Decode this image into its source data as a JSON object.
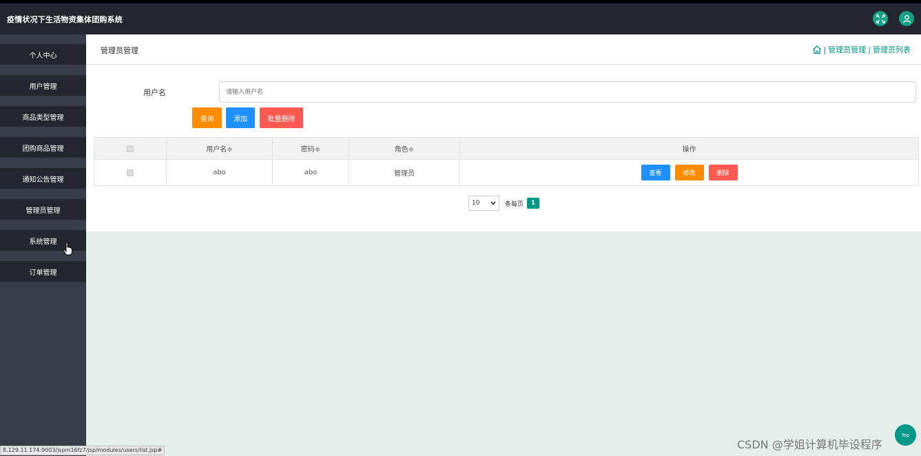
{
  "app": {
    "title": "疫情状况下生活物资集体团购系统"
  },
  "header_icons": [
    "fullscreen-icon",
    "user-icon"
  ],
  "sidebar": {
    "items": [
      {
        "label": "个人中心"
      },
      {
        "label": "用户管理"
      },
      {
        "label": "商品类型管理"
      },
      {
        "label": "团购商品管理"
      },
      {
        "label": "通知公告管理"
      },
      {
        "label": "管理员管理"
      },
      {
        "label": "系统管理"
      },
      {
        "label": "订单管理"
      }
    ]
  },
  "breadcrumb": {
    "page_title": "管理员管理",
    "sep1": "|",
    "level1": "管理员管理",
    "sep2": "|",
    "level2": "管理员列表"
  },
  "search": {
    "label": "用户名",
    "placeholder": "请输入用户名",
    "value": ""
  },
  "actions": {
    "query": "查询",
    "add": "添加",
    "batch_delete": "批量删除"
  },
  "table": {
    "headers": {
      "username": "用户名≑",
      "password": "密码≑",
      "role": "角色≑",
      "ops": "操作"
    },
    "rows": [
      {
        "username": "abo",
        "password": "abo",
        "role": "管理员",
        "view": "查看",
        "edit": "修改",
        "delete": "删除"
      }
    ]
  },
  "pagination": {
    "page_size": "10",
    "per_page_label": "条每页",
    "current_page": "1"
  },
  "statusbar": {
    "url": "8.129.11.174:9003/jspm16fz7/jsp/modules/users/list.jsp#"
  },
  "watermark": "CSDN @学姐计算机毕设程序",
  "to_top": "Top",
  "colors": {
    "header_bg": "#23262e",
    "sidebar_bg": "#393d49",
    "accent": "#009688",
    "orange": "#ff8c00",
    "blue": "#1e90ff",
    "red": "#ff5a52"
  }
}
